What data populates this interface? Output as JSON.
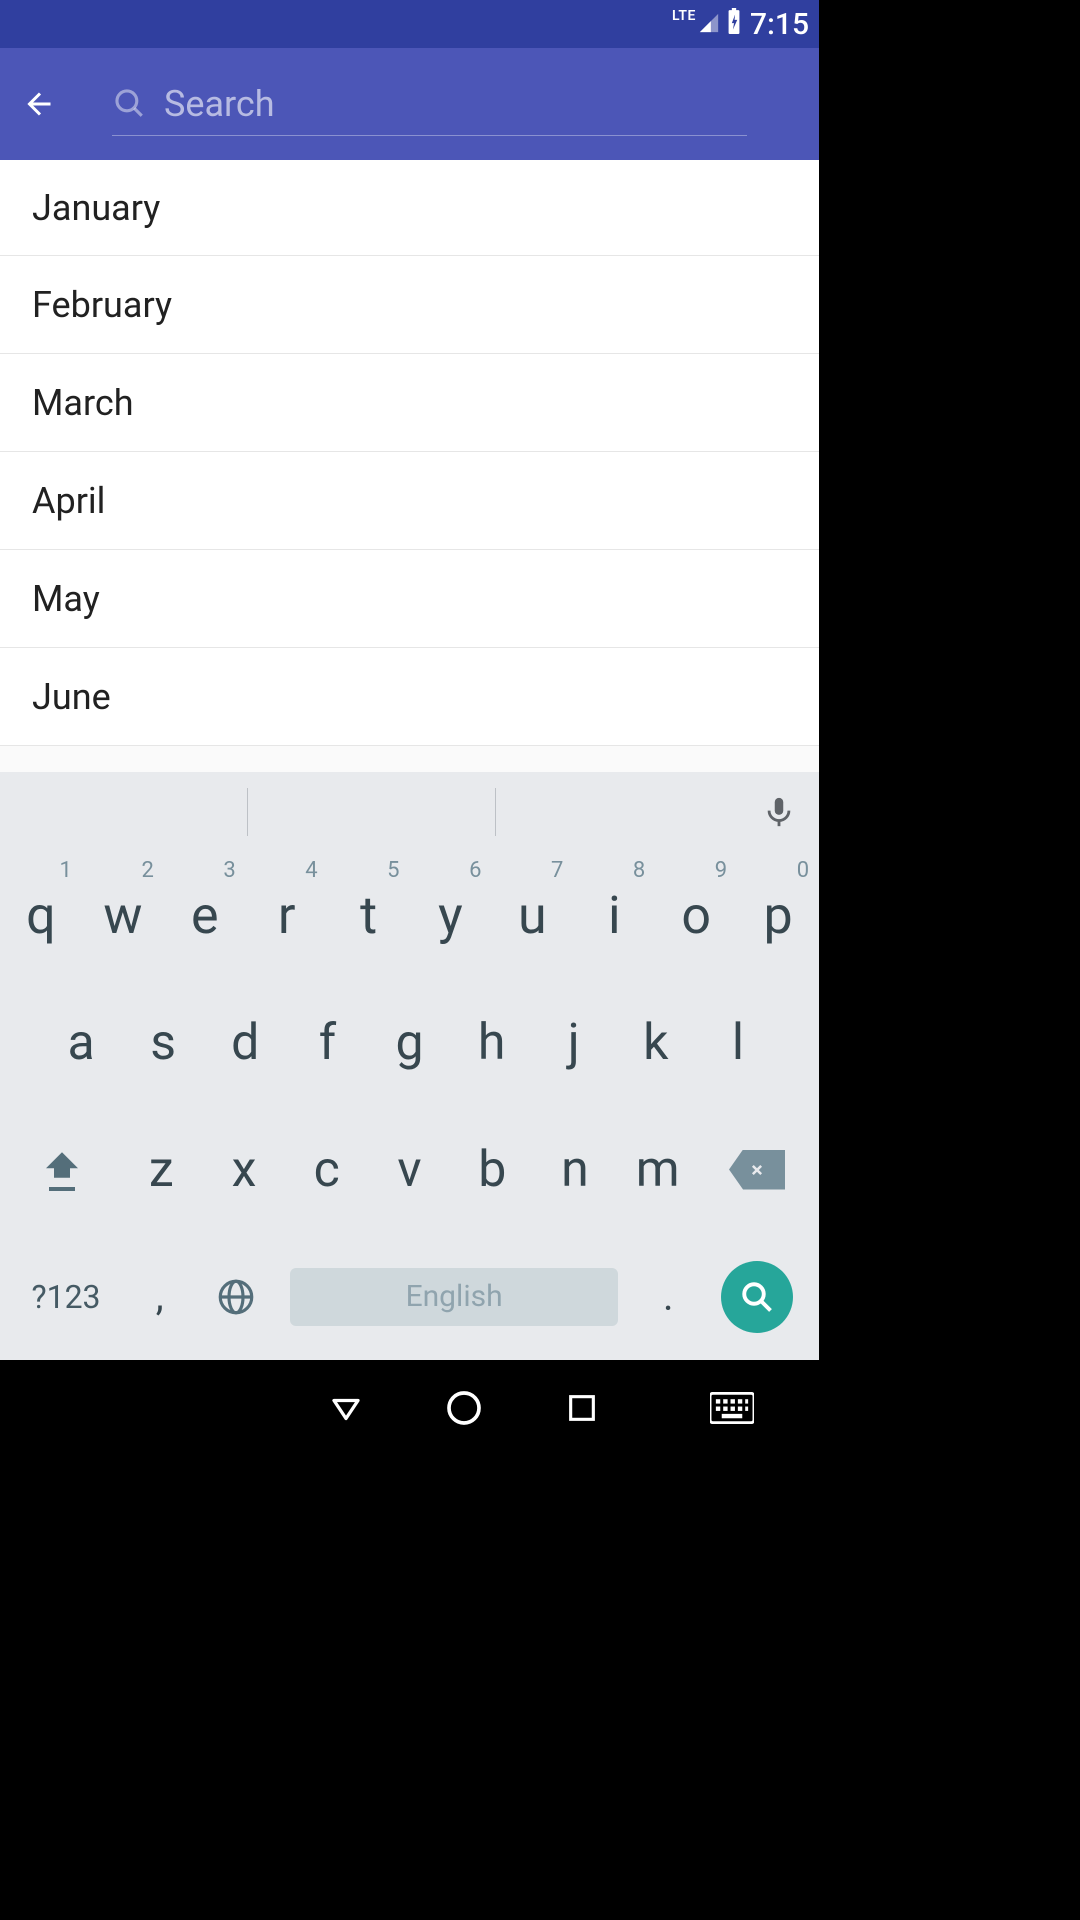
{
  "status": {
    "network_label": "LTE",
    "time": "7:15"
  },
  "toolbar": {
    "search_placeholder": "Search",
    "search_value": ""
  },
  "list": {
    "items": [
      {
        "label": "January"
      },
      {
        "label": "February"
      },
      {
        "label": "March"
      },
      {
        "label": "April"
      },
      {
        "label": "May"
      },
      {
        "label": "June"
      }
    ]
  },
  "keyboard": {
    "row1": [
      {
        "main": "q",
        "hint": "1"
      },
      {
        "main": "w",
        "hint": "2"
      },
      {
        "main": "e",
        "hint": "3"
      },
      {
        "main": "r",
        "hint": "4"
      },
      {
        "main": "t",
        "hint": "5"
      },
      {
        "main": "y",
        "hint": "6"
      },
      {
        "main": "u",
        "hint": "7"
      },
      {
        "main": "i",
        "hint": "8"
      },
      {
        "main": "o",
        "hint": "9"
      },
      {
        "main": "p",
        "hint": "0"
      }
    ],
    "row2": [
      {
        "main": "a"
      },
      {
        "main": "s"
      },
      {
        "main": "d"
      },
      {
        "main": "f"
      },
      {
        "main": "g"
      },
      {
        "main": "h"
      },
      {
        "main": "j"
      },
      {
        "main": "k"
      },
      {
        "main": "l"
      }
    ],
    "row3": [
      {
        "main": "z"
      },
      {
        "main": "x"
      },
      {
        "main": "c"
      },
      {
        "main": "v"
      },
      {
        "main": "b"
      },
      {
        "main": "n"
      },
      {
        "main": "m"
      }
    ],
    "symbols_label": "?123",
    "comma": ",",
    "period": ".",
    "space_label": "English"
  },
  "colors": {
    "primary": "#4C56B7",
    "primary_dark": "#303F9F",
    "keyboard_bg": "#E8EAED",
    "key_text": "#37474F",
    "accent": "#26A69A"
  }
}
